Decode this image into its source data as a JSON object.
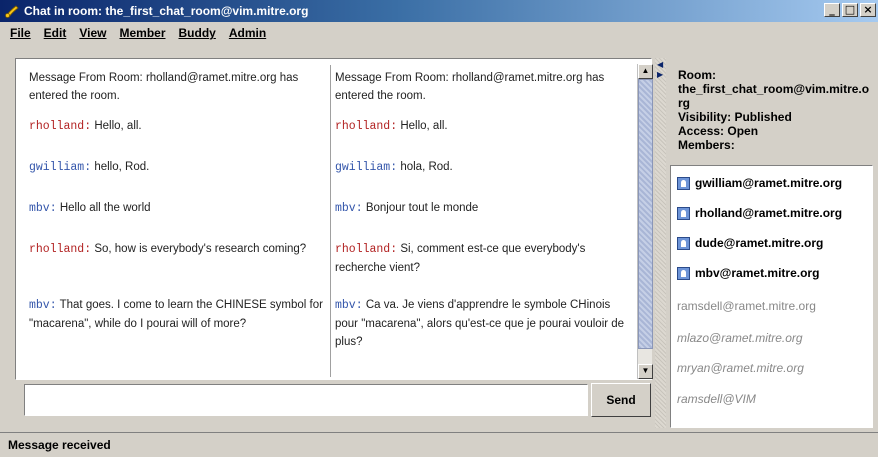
{
  "window": {
    "title": "Chat in room: the_first_chat_room@vim.mitre.org",
    "icon": "phone-icon",
    "controls": [
      "_",
      "□",
      "×"
    ]
  },
  "menu": [
    {
      "label": "File"
    },
    {
      "label": "Edit"
    },
    {
      "label": "View"
    },
    {
      "label": "Member"
    },
    {
      "label": "Buddy"
    },
    {
      "label": "Admin"
    }
  ],
  "chat": {
    "original": [
      {
        "system": "Message From Room: rholland@ramet.mitre.org has entered the room."
      },
      {
        "nick": "rholland:",
        "text": "Hello, all."
      },
      {
        "nick": "gwilliam:",
        "text": "hello, Rod."
      },
      {
        "nick": "mbv:",
        "text": "Hello all the world"
      },
      {
        "nick": "rholland:",
        "text": "So, how is everybody's research coming?"
      },
      {
        "nick": "mbv:",
        "text": "That goes. I come to learn the CHINESE symbol for \"macarena\",  while do I pourai will of more?"
      }
    ],
    "translated": [
      {
        "system": "Message From Room: rholland@ramet.mitre.org has entered the room."
      },
      {
        "nick": "rholland:",
        "text": "Hello, all."
      },
      {
        "nick": "gwilliam:",
        "text": "hola, Rod."
      },
      {
        "nick": "mbv:",
        "text": "Bonjour tout le monde"
      },
      {
        "nick": "rholland:",
        "text": "Si, comment est-ce que everybody's recherche vient?"
      },
      {
        "nick": "mbv:",
        "text": "Ca va.  Je viens d'apprendre le symbole CHinois pour \"macarena\", alors qu'est-ce que je pourai vouloir de plus?"
      }
    ]
  },
  "input": {
    "value": ""
  },
  "send_label": "Send",
  "room": {
    "room_label": "Room:",
    "room_name": "the_first_chat_room@vim.mitre.org",
    "visibility": "Visibility: Published",
    "access": "Access: Open",
    "members_label": "Members:"
  },
  "members": [
    {
      "name": "gwilliam@ramet.mitre.org",
      "status": "online"
    },
    {
      "name": "rholland@ramet.mitre.org",
      "status": "online"
    },
    {
      "name": "dude@ramet.mitre.org",
      "status": "online"
    },
    {
      "name": "mbv@ramet.mitre.org",
      "status": "online"
    },
    {
      "name": "ramsdell@ramet.mitre.org",
      "status": "offline"
    },
    {
      "name": "mlazo@ramet.mitre.org",
      "status": "offline"
    },
    {
      "name": "mryan@ramet.mitre.org",
      "status": "offline"
    },
    {
      "name": "ramsdell@VIM",
      "status": "offline"
    }
  ],
  "status": "Message received",
  "colors": {
    "nick_red": "#b22222",
    "nick_blue": "#3355aa",
    "title_blue": "#0a246a"
  }
}
